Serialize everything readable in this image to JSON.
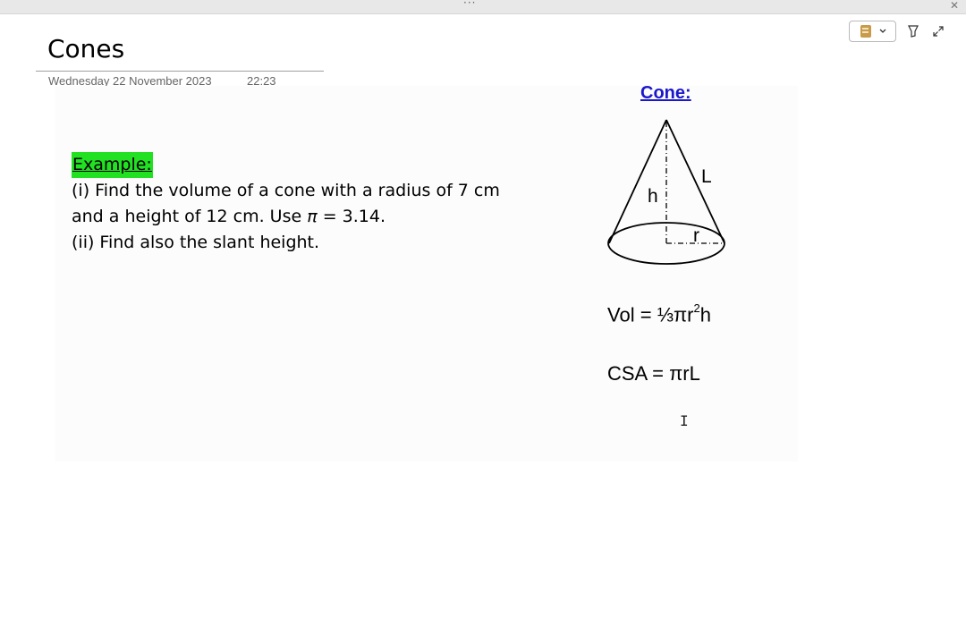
{
  "window": {
    "drag_handle": "···",
    "close_glyph": "✕"
  },
  "toolbar": {
    "notebook_icon": "notebook-icon",
    "chevron_icon": "chevron-down-icon",
    "draw_icon": "highlighter-icon",
    "expand_icon": "expand-icon"
  },
  "page": {
    "title": "Cones",
    "date": "Wednesday 22 November 2023",
    "time": "22:23"
  },
  "example": {
    "label": "Example:",
    "line1": "(i) Find the volume of a cone with a radius of 7 cm",
    "line2_a": "and a height of 12 cm. Use ",
    "line2_pi": "π",
    "line2_b": " = 3.14.",
    "line3": "(ii) Find also the slant height."
  },
  "diagram": {
    "heading": "Cone:",
    "label_h": "h",
    "label_l": "L",
    "label_r": "r"
  },
  "formulas": {
    "vol_prefix": "Vol = ⅓πr",
    "vol_exp": "2",
    "vol_suffix": "h",
    "csa": "CSA = πrL"
  },
  "cursor": {
    "glyph": "I"
  },
  "colors": {
    "highlight": "#22e022",
    "heading_blue": "#1a17cc"
  }
}
